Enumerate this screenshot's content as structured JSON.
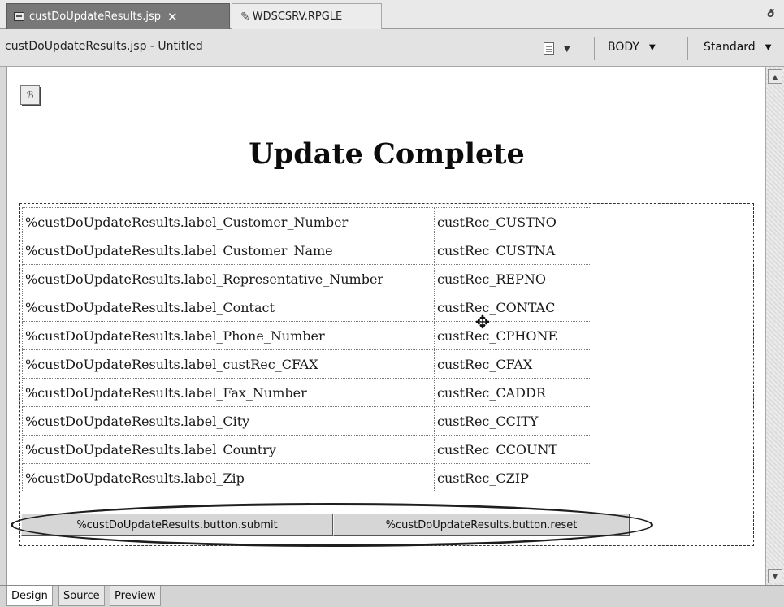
{
  "tabs": [
    {
      "label": "custDoUpdateResults.jsp",
      "active": true,
      "icon": "jsp-file-icon"
    },
    {
      "label": "WDSCSRV.RPGLE",
      "active": false,
      "icon": "pencil-icon"
    }
  ],
  "tab_close_glyph": "✕",
  "toolbar": {
    "editor_title": "custDoUpdateResults.jsp - Untitled",
    "tag_dropdown": "BODY",
    "mode_dropdown": "Standard"
  },
  "page": {
    "heading": "Update Complete",
    "rows": [
      {
        "label": "%custDoUpdateResults.label_Customer_Number",
        "value": "custRec_CUSTNO"
      },
      {
        "label": "%custDoUpdateResults.label_Customer_Name",
        "value": "custRec_CUSTNA"
      },
      {
        "label": "%custDoUpdateResults.label_Representative_Number",
        "value": "custRec_REPNO"
      },
      {
        "label": "%custDoUpdateResults.label_Contact",
        "value": "custRec_CONTAC"
      },
      {
        "label": "%custDoUpdateResults.label_Phone_Number",
        "value": "custRec_CPHONE"
      },
      {
        "label": "%custDoUpdateResults.label_custRec_CFAX",
        "value": "custRec_CFAX"
      },
      {
        "label": "%custDoUpdateResults.label_Fax_Number",
        "value": "custRec_CADDR"
      },
      {
        "label": "%custDoUpdateResults.label_City",
        "value": "custRec_CCITY"
      },
      {
        "label": "%custDoUpdateResults.label_Country",
        "value": "custRec_CCOUNT"
      },
      {
        "label": "%custDoUpdateResults.label_Zip",
        "value": "custRec_CZIP"
      }
    ],
    "submit_button": "%custDoUpdateResults.button.submit",
    "reset_button": "%custDoUpdateResults.button.reset"
  },
  "view_tabs": [
    "Design",
    "Source",
    "Preview"
  ]
}
